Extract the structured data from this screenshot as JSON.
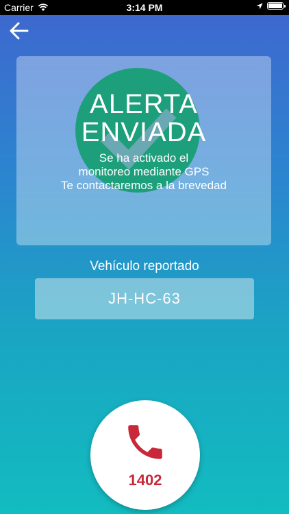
{
  "status_bar": {
    "carrier": "Carrier",
    "time": "3:14 PM",
    "icons": [
      "wifi-icon",
      "location-arrow-icon",
      "battery-icon"
    ]
  },
  "nav": {
    "back_icon": "arrow-left-icon"
  },
  "alert": {
    "title_line1": "ALERTA",
    "title_line2": "ENVIADA",
    "message_line1": "Se ha activado el",
    "message_line2": "monitoreo mediante GPS",
    "message_line3": "Te contactaremos a la brevedad",
    "badge_color": "#1e9f7c",
    "badge_icon": "checkmark-icon"
  },
  "vehicle": {
    "label": "Vehículo reportado",
    "plate": "JH-HC-63"
  },
  "call": {
    "number": "1402",
    "icon": "phone-icon",
    "color": "#c8283a"
  }
}
